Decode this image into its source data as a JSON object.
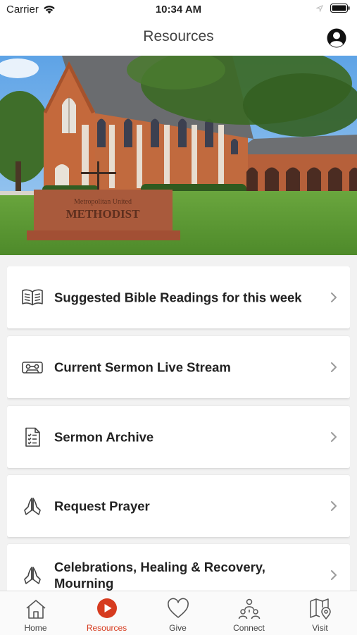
{
  "status_bar": {
    "carrier": "Carrier",
    "time": "10:34 AM"
  },
  "nav": {
    "title": "Resources"
  },
  "colors": {
    "accent": "#d63b1f",
    "card_bg": "#ffffff",
    "page_bg": "#f2f2f2"
  },
  "hero": {
    "sign_text_line1": "Metropolitan United",
    "sign_text_line2": "METHODIST"
  },
  "resources": [
    {
      "label": "Suggested Bible Readings for this week",
      "icon": "open-book-icon"
    },
    {
      "label": "Current Sermon Live Stream",
      "icon": "cassette-icon"
    },
    {
      "label": "Sermon Archive",
      "icon": "checklist-document-icon"
    },
    {
      "label": "Request Prayer",
      "icon": "praying-hands-icon"
    },
    {
      "label": "Celebrations, Healing & Recovery, Mourning",
      "icon": "praying-hands-icon"
    }
  ],
  "tabs": [
    {
      "label": "Home",
      "icon": "home-icon",
      "active": false
    },
    {
      "label": "Resources",
      "icon": "play-circle-icon",
      "active": true
    },
    {
      "label": "Give",
      "icon": "heart-icon",
      "active": false
    },
    {
      "label": "Connect",
      "icon": "people-icon",
      "active": false
    },
    {
      "label": "Visit",
      "icon": "map-pin-icon",
      "active": false
    }
  ]
}
